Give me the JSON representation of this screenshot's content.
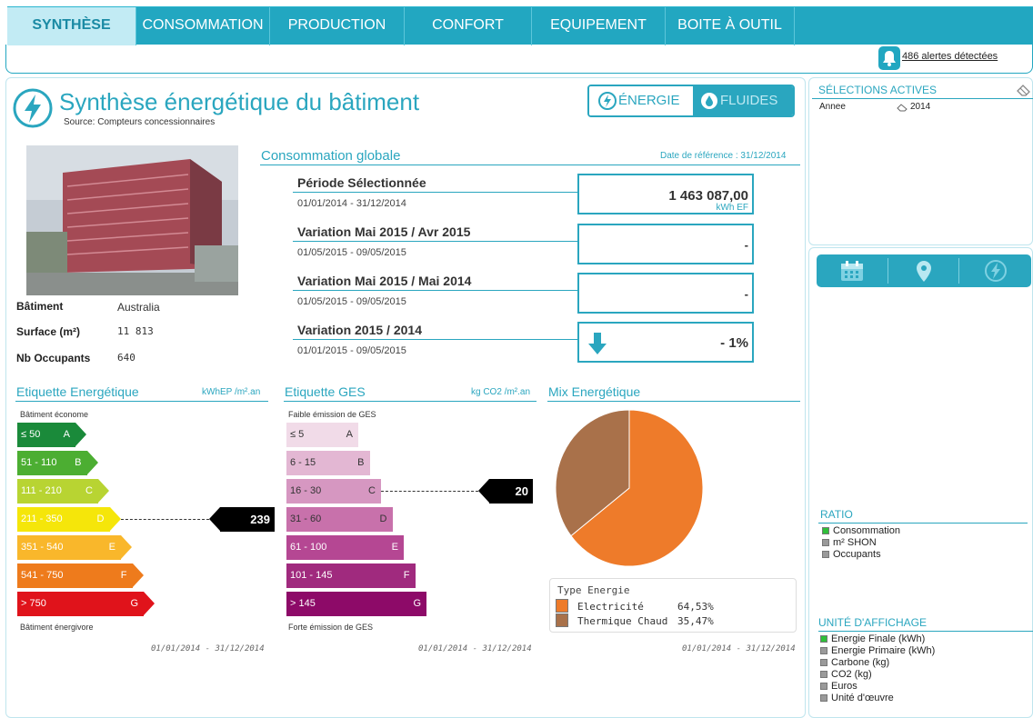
{
  "nav": {
    "tabs": [
      "SYNTHÈSE",
      "CONSOMMATION",
      "PRODUCTION",
      "CONFORT",
      "EQUIPEMENT",
      "BOITE À OUTIL"
    ],
    "active": 0
  },
  "alerts": {
    "text": "486 alertes détectées"
  },
  "header": {
    "title": "Synthèse énergétique du bâtiment",
    "source": "Source: Compteurs concessionnaires",
    "toggle_energy": "ÉNERGIE",
    "toggle_fluids": "FLUIDES"
  },
  "building": {
    "rows": [
      {
        "label": "Bâtiment",
        "value": "Australia"
      },
      {
        "label": "Surface (m²)",
        "value": "11 813"
      },
      {
        "label": "Nb Occupants",
        "value": "640"
      }
    ]
  },
  "consumption": {
    "title": "Consommation globale",
    "ref_date": "Date de référence : 31/12/2014",
    "items": [
      {
        "label": "Période Sélectionnée",
        "dates": "01/01/2014 - 31/12/2014",
        "value": "1 463 087,00",
        "unit": "kWh EF"
      },
      {
        "label": "Variation Mai 2015 / Avr 2015",
        "dates": "01/05/2015 - 09/05/2015",
        "value": "-",
        "unit": ""
      },
      {
        "label": "Variation Mai 2015 / Mai 2014",
        "dates": "01/05/2015 - 09/05/2015",
        "value": "-",
        "unit": ""
      },
      {
        "label": "Variation 2015 / 2014",
        "dates": "01/01/2015 - 09/05/2015",
        "value": "- 1%",
        "unit": ""
      }
    ]
  },
  "energy_label": {
    "title": "Etiquette Energétique",
    "unit": "kWhEP /m².an",
    "top": "Bâtiment économe",
    "bottom": "Bâtiment énergivore",
    "date": "01/01/2014 - 31/12/2014",
    "value": "239",
    "classes": [
      {
        "range": "≤ 50",
        "letter": "A",
        "color": "#1a8a3a"
      },
      {
        "range": "51 - 110",
        "letter": "B",
        "color": "#4cae32"
      },
      {
        "range": "111 - 210",
        "letter": "C",
        "color": "#b8d432"
      },
      {
        "range": "211 - 350",
        "letter": "D",
        "color": "#f5e60a"
      },
      {
        "range": "351 - 540",
        "letter": "E",
        "color": "#f9b72b"
      },
      {
        "range": "541 - 750",
        "letter": "F",
        "color": "#ee7b1c"
      },
      {
        "range": "> 750",
        "letter": "G",
        "color": "#e0131b"
      }
    ]
  },
  "ges_label": {
    "title": "Etiquette GES",
    "unit": "kg CO2 /m².an",
    "top": "Faible émission de GES",
    "bottom": "Forte émission de GES",
    "date": "01/01/2014 - 31/12/2014",
    "value": "20",
    "classes": [
      {
        "range": "≤ 5",
        "letter": "A",
        "color": "#f1dbe8"
      },
      {
        "range": "6 - 15",
        "letter": "B",
        "color": "#e3b7d3"
      },
      {
        "range": "16 - 30",
        "letter": "C",
        "color": "#d697c1"
      },
      {
        "range": "31 - 60",
        "letter": "D",
        "color": "#c871ab"
      },
      {
        "range": "61 - 100",
        "letter": "E",
        "color": "#b54793"
      },
      {
        "range": "101 - 145",
        "letter": "F",
        "color": "#a02a7e"
      },
      {
        "range": "> 145",
        "letter": "G",
        "color": "#8d0a68"
      }
    ]
  },
  "mix": {
    "title": "Mix Energétique",
    "legend_title": "Type Energie",
    "date": "01/01/2014 - 31/12/2014",
    "chart_data": {
      "type": "pie",
      "series": [
        {
          "name": "Electricité",
          "value": 64.53,
          "label": "64,53%",
          "color": "#ee7b2a"
        },
        {
          "name": "Thermique Chaud",
          "value": 35.47,
          "label": "35,47%",
          "color": "#a9714a"
        }
      ]
    }
  },
  "selections": {
    "title": "SÉLECTIONS ACTIVES",
    "key": "Annee",
    "value": "2014"
  },
  "ratio": {
    "title": "RATIO",
    "options": [
      {
        "label": "Consommation",
        "active": true
      },
      {
        "label": "m² SHON",
        "active": false
      },
      {
        "label": "Occupants",
        "active": false
      }
    ]
  },
  "unit": {
    "title": "UNITÉ D'AFFICHAGE",
    "options": [
      {
        "label": "Energie Finale (kWh)",
        "active": true
      },
      {
        "label": "Energie Primaire (kWh)",
        "active": false
      },
      {
        "label": "Carbone (kg)",
        "active": false
      },
      {
        "label": "CO2 (kg)",
        "active": false
      },
      {
        "label": "Euros",
        "active": false
      },
      {
        "label": "Unité d'œuvre",
        "active": false
      }
    ]
  }
}
